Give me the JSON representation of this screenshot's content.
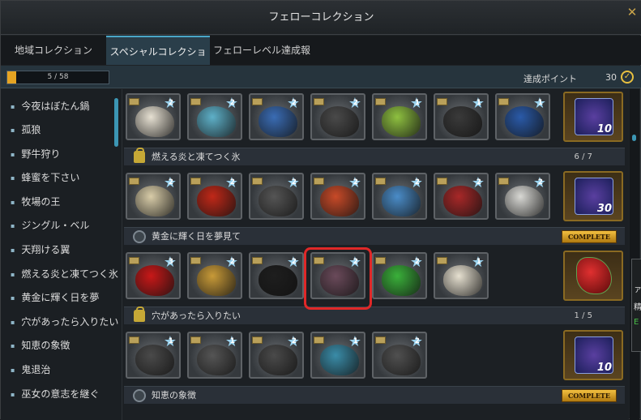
{
  "window": {
    "title": "フェローコレクション",
    "close_icon": "close-icon"
  },
  "tabs": [
    {
      "label": "地域コレクション",
      "active": false
    },
    {
      "label": "スペシャルコレクション",
      "active": true
    },
    {
      "label": "フェローレベル達成報酬",
      "active": false
    }
  ],
  "progress": {
    "text": "5 / 58",
    "value": 5,
    "max": 58,
    "color": "#e6a422"
  },
  "achievement": {
    "label": "達成ポイント",
    "points": "30"
  },
  "sidebar": {
    "items": [
      {
        "label": "今夜はぼたん鍋"
      },
      {
        "label": "孤狼"
      },
      {
        "label": "野牛狩り"
      },
      {
        "label": "蜂蜜を下さい"
      },
      {
        "label": "牧場の王"
      },
      {
        "label": "ジングル・ベル"
      },
      {
        "label": "天翔ける翼"
      },
      {
        "label": "燃える炎と凍てつく氷"
      },
      {
        "label": "黄金に輝く日を夢"
      },
      {
        "label": "穴があったら入りたい"
      },
      {
        "label": "知恵の象徴"
      },
      {
        "label": "鬼退治"
      },
      {
        "label": "巫女の意志を継ぐ"
      }
    ]
  },
  "sections": [
    {
      "title": "",
      "count": "",
      "status": "",
      "cards": [
        {
          "level": "2",
          "color": "#e6e0d2"
        },
        {
          "level": "2",
          "color": "#5eb0c8"
        },
        {
          "level": "2",
          "color": "#3a6cb4"
        },
        {
          "level": "2",
          "color": "#4a4a4a"
        },
        {
          "level": "1",
          "color": "#8ec040"
        },
        {
          "level": "1",
          "color": "#3a3a3a"
        },
        {
          "level": "1",
          "color": "#2a5aa8"
        }
      ],
      "reward": {
        "type": "box",
        "count": "10"
      }
    },
    {
      "title": "燃える炎と凍てつく氷",
      "count": "6 / 7",
      "status": "locked",
      "cards": [
        {
          "level": "2",
          "color": "#d8cca8"
        },
        {
          "level": "2",
          "color": "#c02818"
        },
        {
          "level": "2",
          "color": "#555555"
        },
        {
          "level": "2",
          "color": "#c84a28"
        },
        {
          "level": "2",
          "color": "#4a8cc8"
        },
        {
          "level": "2",
          "color": "#a82828"
        },
        {
          "level": "2",
          "color": "#d8d8d4"
        }
      ],
      "reward": {
        "type": "box",
        "count": "30"
      }
    },
    {
      "title": "黄金に輝く日を夢見て",
      "count": "",
      "status": "COMPLETE",
      "cards": [
        {
          "level": "3",
          "color": "#c81818"
        },
        {
          "level": "2",
          "color": "#c89a38"
        },
        {
          "level": "2",
          "color": "#1e1e1e"
        },
        {
          "level": "2",
          "color": "#6a4a5a"
        },
        {
          "level": "2",
          "color": "#3ab03a"
        },
        {
          "level": "1",
          "color": "#e6e0d0"
        }
      ],
      "reward": {
        "type": "dragon",
        "count": ""
      }
    },
    {
      "title": "穴があったら入りたい",
      "count": "1 / 5",
      "status": "locked",
      "cards": [
        {
          "level": "1",
          "color": "#4a4a4a"
        },
        {
          "level": "1",
          "color": "#555555"
        },
        {
          "level": "2",
          "color": "#4a4a4a"
        },
        {
          "level": "1",
          "color": "#3a8ca8"
        },
        {
          "level": "2",
          "color": "#505050"
        }
      ],
      "reward": {
        "type": "box",
        "count": "10"
      }
    },
    {
      "title": "知恵の象徴",
      "count": "",
      "status": "COMPLETE",
      "cards": [],
      "reward": null
    }
  ],
  "tooltip": {
    "lines": [
      "ァ",
      "精",
      "E"
    ]
  }
}
